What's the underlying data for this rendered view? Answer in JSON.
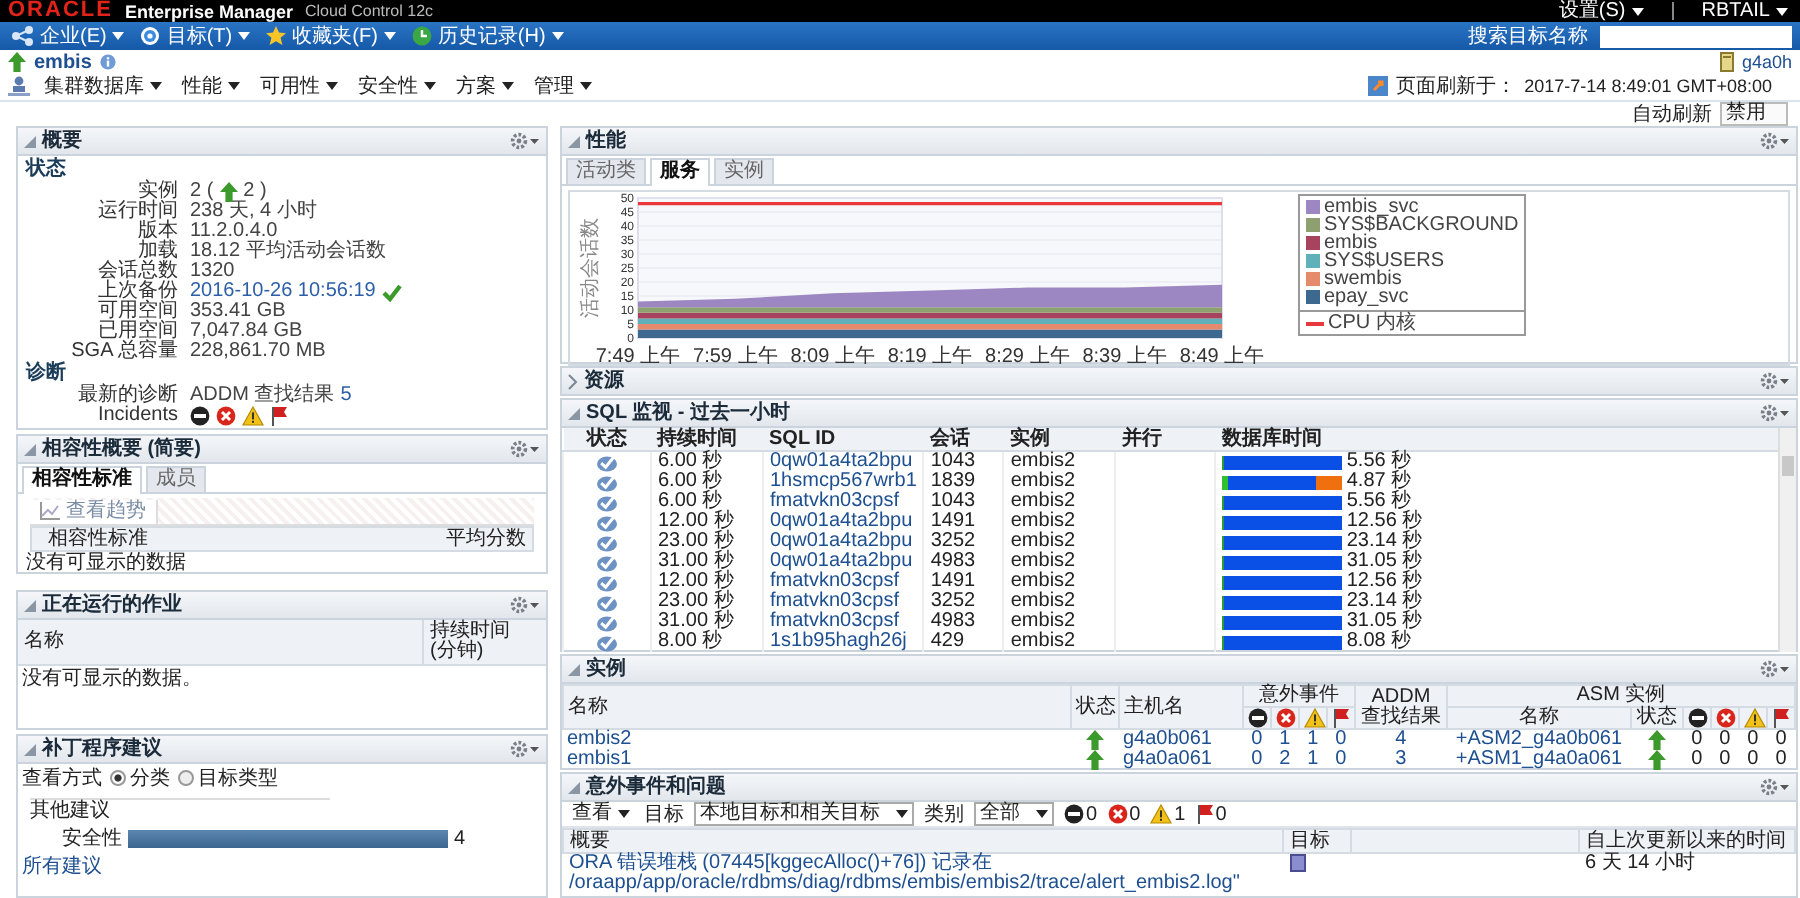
{
  "masthead": {
    "logo": "ORACLE",
    "product": "Enterprise Manager",
    "edition": "Cloud Control 12c",
    "menus": [
      "设置(S)",
      "RBTAIL"
    ]
  },
  "nav": {
    "menus": [
      "企业(E)",
      "目标(T)",
      "收藏夹(F)",
      "历史记录(H)"
    ],
    "search_label": "搜索目标名称"
  },
  "target": {
    "name": "embis",
    "host": "g4a0h",
    "menus": [
      "集群数据库",
      "性能",
      "可用性",
      "安全性",
      "方案",
      "管理"
    ],
    "refresh_label": "页面刷新于：",
    "refresh_time": "2017-7-14 8:49:01 GMT+08:00",
    "auto_refresh_label": "自动刷新",
    "auto_refresh_value": "禁用"
  },
  "summary": {
    "title": "概要",
    "sections": [
      {
        "heading": "状态",
        "rows": [
          {
            "kind": "instances",
            "label": "实例",
            "value": "2 (",
            "suffix": "2 )"
          },
          {
            "kind": "text",
            "label": "运行时间",
            "value": "238 天, 4 小时"
          },
          {
            "kind": "text",
            "label": "版本",
            "value": "11.2.0.4.0"
          },
          {
            "kind": "text",
            "label": "加载",
            "value": "18.12 平均活动会话数"
          },
          {
            "kind": "text",
            "label": "会话总数",
            "value": "1320"
          },
          {
            "kind": "backup",
            "label": "上次备份",
            "value": "2016-10-26 10:56:19"
          },
          {
            "kind": "text",
            "label": "可用空间",
            "value": "353.41 GB"
          },
          {
            "kind": "text",
            "label": "已用空间",
            "value": "7,047.84 GB"
          },
          {
            "kind": "text",
            "label": "SGA 总容量",
            "value": "228,861.70 MB"
          }
        ]
      },
      {
        "heading": "诊断",
        "rows": [
          {
            "kind": "findings",
            "label": "最新的诊断",
            "value": "ADDM 查找结果",
            "count": "5"
          },
          {
            "kind": "incidents",
            "label": "Incidents"
          }
        ]
      }
    ]
  },
  "compliance": {
    "title": "相容性概要 (简要)",
    "tabs": [
      {
        "label": "相容性标准",
        "selected": true
      },
      {
        "label": "成员",
        "selected": false
      }
    ],
    "trend_button": "查看趋势",
    "columns": [
      "相容性标准",
      "平均分数"
    ],
    "empty_text": "没有可显示的数据"
  },
  "jobs": {
    "title": "正在运行的作业",
    "columns": [
      "名称",
      "持续时间 (分钟)"
    ],
    "empty_text": "没有可显示的数据。"
  },
  "patches": {
    "title": "补丁程序建议",
    "view_label": "查看方式",
    "view_options": [
      {
        "label": "分类",
        "selected": true
      },
      {
        "label": "目标类型",
        "selected": false
      }
    ],
    "group": "其他建议",
    "bars": [
      {
        "label": "安全性",
        "level": 1,
        "value": "4"
      }
    ],
    "link": "所有建议"
  },
  "performance": {
    "title": "性能",
    "tabs": [
      {
        "label": "活动类",
        "selected": false
      },
      {
        "label": "服务",
        "selected": true
      },
      {
        "label": "实例",
        "selected": false
      }
    ],
    "chart_data": {
      "type": "area",
      "stacked": true,
      "grid": true,
      "ylabel": "活动会话数",
      "categories": [
        "7:49 上午",
        "7:59 上午",
        "8:09 上午",
        "8:19 上午",
        "8:29 上午",
        "8:39 上午",
        "8:49 上午"
      ],
      "ylim": [
        0,
        50
      ],
      "yticks": [
        0,
        5,
        10,
        15,
        20,
        25,
        30,
        35,
        40,
        45,
        50
      ],
      "series": [
        {
          "name": "epay_svc",
          "color": "#3d6991",
          "values": [
            3,
            3,
            3,
            3,
            3,
            3,
            3
          ]
        },
        {
          "name": "swembis",
          "color": "#e58a6a",
          "values": [
            2,
            2,
            2,
            2,
            2,
            2,
            2
          ]
        },
        {
          "name": "SYS$USERS",
          "color": "#5fb0b8",
          "values": [
            2,
            2,
            2,
            2,
            2,
            2,
            2
          ]
        },
        {
          "name": "embis",
          "color": "#a8435f",
          "values": [
            2,
            2,
            2,
            2,
            2,
            2,
            2
          ]
        },
        {
          "name": "SYS$BACKGROUND",
          "color": "#8fa070",
          "values": [
            2,
            2,
            2,
            2,
            2,
            2,
            2
          ]
        },
        {
          "name": "embis_svc",
          "color": "#9d87c2",
          "values": [
            2,
            3,
            5,
            6,
            7,
            7,
            8
          ]
        },
        {
          "name": "CPU 内核",
          "color": "#e8383d",
          "type": "line",
          "values": [
            48,
            48,
            48,
            48,
            48,
            48,
            48
          ]
        }
      ]
    }
  },
  "resources": {
    "title": "资源",
    "expanded": false
  },
  "sql_monitor": {
    "title": "SQL 监视 - 过去一小时",
    "columns": [
      "状态",
      "持续时间",
      "SQL ID",
      "会话",
      "实例",
      "并行",
      "数据库时间"
    ],
    "rows": [
      {
        "duration": "6.00 秒",
        "sql_id": "0qw01a4ta2bpu",
        "session": "1043",
        "instance": "embis2",
        "db_time": "5.56 秒",
        "time_bar": [
          {
            "color": "#2e9a2e",
            "level": 0.01
          },
          {
            "color": "#0a50e6",
            "level": 0.99
          }
        ]
      },
      {
        "duration": "6.00 秒",
        "sql_id": "1hsmcp567wrb1",
        "session": "1839",
        "instance": "embis2",
        "db_time": "4.87 秒",
        "time_bar": [
          {
            "color": "#2ec02e",
            "level": 0.05
          },
          {
            "color": "#0a50e6",
            "level": 0.72
          },
          {
            "color": "#f07010",
            "level": 0.23
          }
        ]
      },
      {
        "duration": "6.00 秒",
        "sql_id": "fmatvkn03cpsf",
        "session": "1043",
        "instance": "embis2",
        "db_time": "5.56 秒",
        "time_bar": [
          {
            "color": "#2e9a2e",
            "level": 0.01
          },
          {
            "color": "#0a50e6",
            "level": 0.99
          }
        ]
      },
      {
        "duration": "12.00 秒",
        "sql_id": "0qw01a4ta2bpu",
        "session": "1491",
        "instance": "embis2",
        "db_time": "12.56 秒",
        "time_bar": [
          {
            "color": "#2e9a2e",
            "level": 0.01
          },
          {
            "color": "#0a50e6",
            "level": 0.99
          }
        ]
      },
      {
        "duration": "23.00 秒",
        "sql_id": "0qw01a4ta2bpu",
        "session": "3252",
        "instance": "embis2",
        "db_time": "23.14 秒",
        "time_bar": [
          {
            "color": "#2e9a2e",
            "level": 0.01
          },
          {
            "color": "#0a50e6",
            "level": 0.99
          }
        ]
      },
      {
        "duration": "31.00 秒",
        "sql_id": "0qw01a4ta2bpu",
        "session": "4983",
        "instance": "embis2",
        "db_time": "31.05 秒",
        "time_bar": [
          {
            "color": "#2e9a2e",
            "level": 0.01
          },
          {
            "color": "#0a50e6",
            "level": 0.99
          }
        ]
      },
      {
        "duration": "12.00 秒",
        "sql_id": "fmatvkn03cpsf",
        "session": "1491",
        "instance": "embis2",
        "db_time": "12.56 秒",
        "time_bar": [
          {
            "color": "#2e9a2e",
            "level": 0.01
          },
          {
            "color": "#0a50e6",
            "level": 0.99
          }
        ]
      },
      {
        "duration": "23.00 秒",
        "sql_id": "fmatvkn03cpsf",
        "session": "3252",
        "instance": "embis2",
        "db_time": "23.14 秒",
        "time_bar": [
          {
            "color": "#2e9a2e",
            "level": 0.01
          },
          {
            "color": "#0a50e6",
            "level": 0.99
          }
        ]
      },
      {
        "duration": "31.00 秒",
        "sql_id": "fmatvkn03cpsf",
        "session": "4983",
        "instance": "embis2",
        "db_time": "31.05 秒",
        "time_bar": [
          {
            "color": "#2e9a2e",
            "level": 0.01
          },
          {
            "color": "#0a50e6",
            "level": 0.99
          }
        ]
      },
      {
        "duration": "8.00 秒",
        "sql_id": "1s1b95hagh26j",
        "session": "429",
        "instance": "embis2",
        "db_time": "8.08 秒",
        "time_bar": [
          {
            "color": "#2e9a2e",
            "level": 0.01
          },
          {
            "color": "#0a50e6",
            "level": 0.99
          }
        ]
      }
    ]
  },
  "instances": {
    "title": "实例",
    "columns": {
      "name": "名称",
      "status": "状态",
      "host": "主机名",
      "incidents": "意外事件",
      "addm": "ADDM 查找结果",
      "asm": "ASM 实例",
      "asm_name": "名称",
      "asm_status": "状态"
    },
    "rows": [
      {
        "name": "embis2",
        "online": true,
        "host": "g4a0b061",
        "incidents": [
          "0",
          "1",
          "1",
          "0"
        ],
        "addm": "4",
        "asm_name": "+ASM2_g4a0b061",
        "asm_online": true,
        "asm_incidents": [
          "0",
          "0",
          "0",
          "0"
        ]
      },
      {
        "name": "embis1",
        "online": true,
        "host": "g4a0a061",
        "incidents": [
          "0",
          "2",
          "1",
          "0"
        ],
        "addm": "3",
        "asm_name": "+ASM1_g4a0a061",
        "asm_online": true,
        "asm_incidents": [
          "0",
          "0",
          "0",
          "0"
        ]
      }
    ]
  },
  "incidents": {
    "title": "意外事件和问题",
    "view_menu": "查看",
    "target_label": "目标",
    "target_value": "本地目标和相关目标",
    "category_label": "类别",
    "category_value": "全部",
    "counts": [
      {
        "kind": "minus",
        "count": "0"
      },
      {
        "kind": "error",
        "count": "0"
      },
      {
        "kind": "warning",
        "count": "1"
      },
      {
        "kind": "flag",
        "count": "0"
      }
    ],
    "columns": [
      "概要",
      "目标",
      "自上次更新以来的时间"
    ],
    "rows": [
      {
        "summary": "ORA 错误堆栈 (07445[kggecAlloc()+76]) 记录在 /oraapp/app/oracle/rdbms/diag/rdbms/embis/embis2/trace/alert_embis2.log\"",
        "time": "6 天 14 小时"
      }
    ]
  }
}
